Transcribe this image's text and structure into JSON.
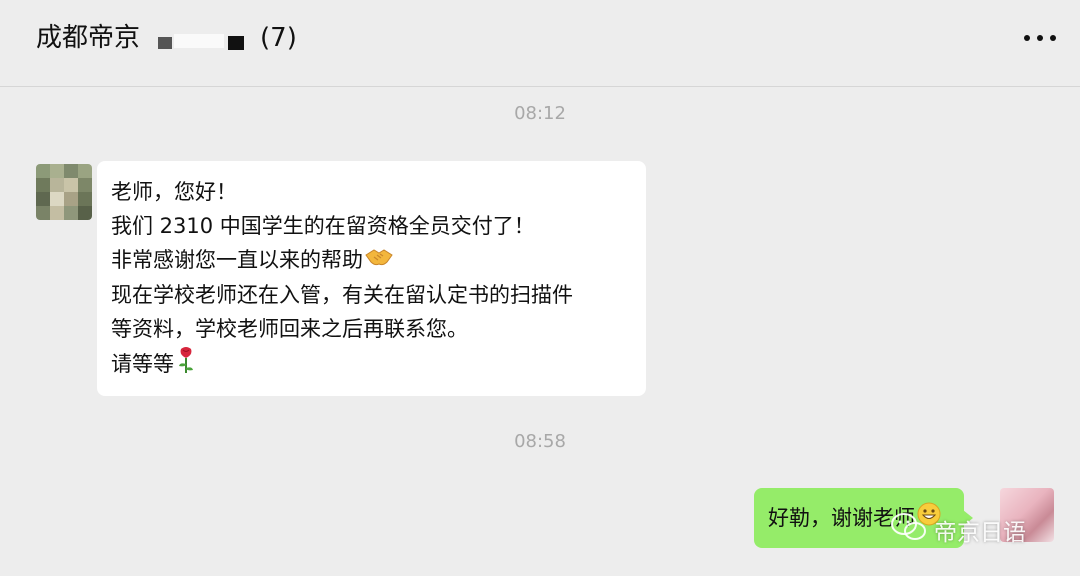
{
  "header": {
    "title": "成都帝京",
    "count": "(7)",
    "more_icon": "more-dots-icon"
  },
  "messages": [
    {
      "time": "08:12",
      "sender": "other",
      "lines": [
        "老师，您好！",
        "我们 2310 中国学生的在留资格全员交付了！",
        "非常感谢您一直以来的帮助",
        "现在学校老师还在入管，有关在留认定书的扫描件",
        "等资料，学校老师回来之后再联系您。",
        "请等等"
      ],
      "emojis": [
        "handshake-emoji",
        "rose-emoji"
      ]
    },
    {
      "time": "08:58",
      "sender": "me",
      "text": "好勒，谢谢老师",
      "emoji": "grinning-face-emoji"
    }
  ],
  "watermark": {
    "text": "帝京日语",
    "icon": "wechat-icon"
  },
  "colors": {
    "background": "#ededed",
    "bubble_other": "#ffffff",
    "bubble_me": "#95ec69",
    "timestamp": "#a8a8a8"
  }
}
